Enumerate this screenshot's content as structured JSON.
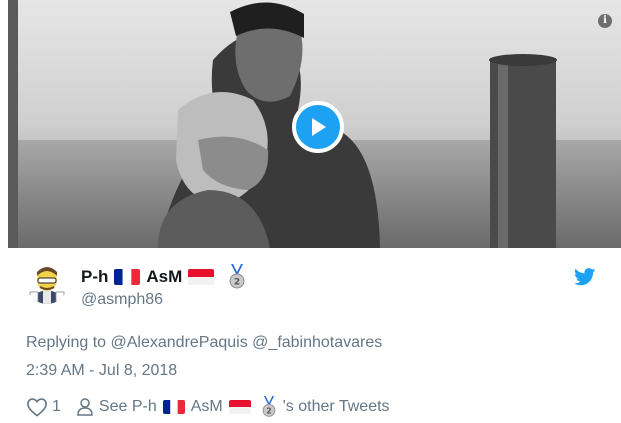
{
  "media": {
    "play_icon": "play-icon",
    "info_icon": "info-icon",
    "info_glyph": "i"
  },
  "author": {
    "display_name_part1": "P-h",
    "display_name_part2": "AsM",
    "handle": "@asmph86",
    "flag1": "france-flag-icon",
    "flag2": "indonesia-flag-icon",
    "badge": "medal-icon"
  },
  "tweet": {
    "replying_prefix": "Replying to",
    "mention1": "@AlexandrePaquis",
    "mention2": "@_fabinhotavares",
    "timestamp": "2:39 AM - Jul 8, 2018"
  },
  "footer": {
    "like_count": "1",
    "see_prefix": "See P-h",
    "see_middle": "AsM",
    "see_suffix": "'s other Tweets"
  },
  "colors": {
    "accent": "#1da1f2",
    "secondary_text": "#657786",
    "primary_text": "#14171a"
  }
}
